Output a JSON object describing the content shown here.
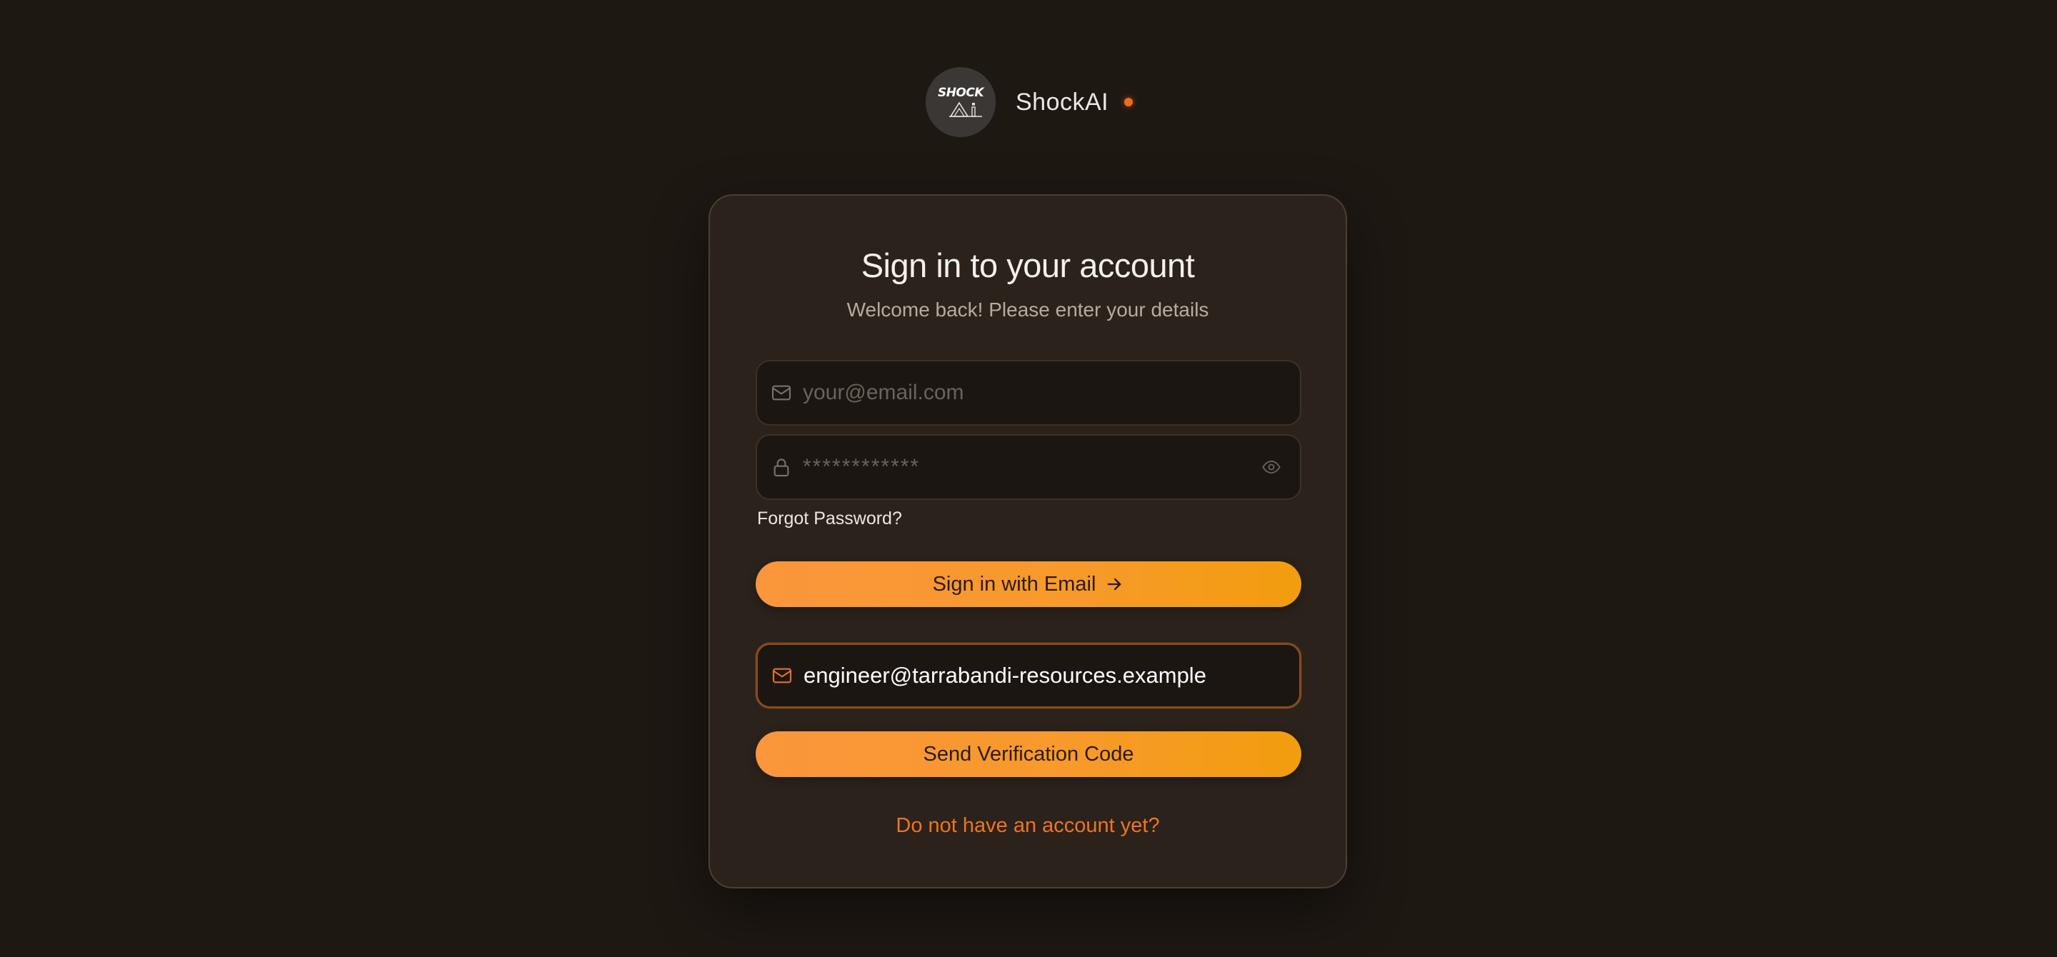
{
  "brand": {
    "logo_word": "SHOCK",
    "name": "ShockAI",
    "accent_color": "#f26a1b"
  },
  "card": {
    "title": "Sign in to your account",
    "subtitle": "Welcome back! Please enter your details"
  },
  "email_field": {
    "icon": "mail-icon",
    "value": "",
    "placeholder": "your@email.com"
  },
  "password_field": {
    "icon": "lock-icon",
    "value": "",
    "placeholder": "************",
    "toggle_icon": "eye-icon"
  },
  "forgot_password_label": "Forgot Password?",
  "sign_in_button": {
    "label": "Sign in with Email",
    "icon": "arrow-right-icon"
  },
  "verification_email_field": {
    "icon": "mail-icon",
    "value": "engineer@tarrabandi-resources.example",
    "placeholder": ""
  },
  "send_code_button": {
    "label": "Send Verification Code"
  },
  "signup_link": "Do not have an account yet?",
  "colors": {
    "background": "#1e1813",
    "card": "#2a221b",
    "button_gradient_start": "#fb963c",
    "button_gradient_end": "#f29d0e",
    "link": "#f0741e"
  }
}
